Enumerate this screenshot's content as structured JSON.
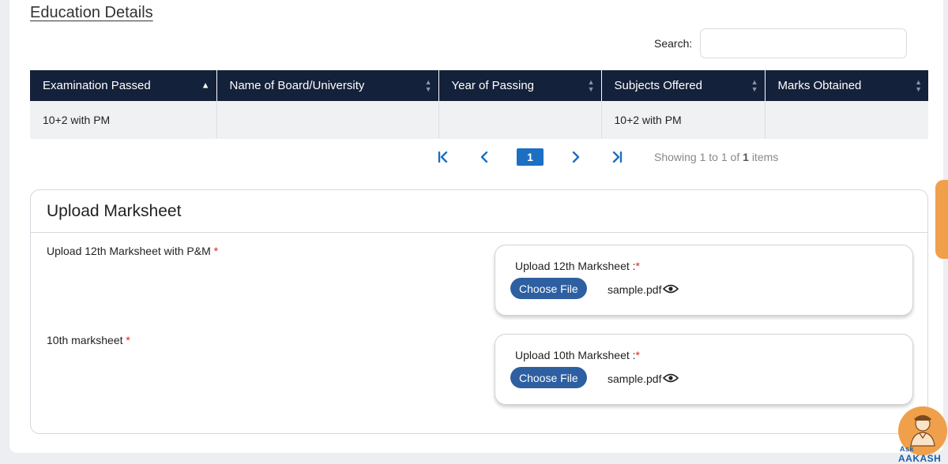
{
  "section": {
    "title": "Education Details"
  },
  "search": {
    "label": "Search:",
    "value": ""
  },
  "table": {
    "columns": [
      {
        "label": "Examination Passed",
        "sorted": "asc"
      },
      {
        "label": "Name of Board/University",
        "sorted": "none"
      },
      {
        "label": "Year of Passing",
        "sorted": "none"
      },
      {
        "label": "Subjects Offered",
        "sorted": "none"
      },
      {
        "label": "Marks Obtained",
        "sorted": "none"
      }
    ],
    "rows": [
      [
        "10+2 with PM",
        "",
        "",
        "10+2 with PM",
        ""
      ]
    ]
  },
  "pagination": {
    "current_page": "1",
    "info_prefix": "Showing",
    "info_from": "1",
    "info_to_word": "to",
    "info_to": "1",
    "info_of_word": "of",
    "info_total": "1",
    "info_suffix": "items"
  },
  "upload": {
    "title": "Upload Marksheet",
    "fields": [
      {
        "label": "Upload 12th Marksheet with P&M",
        "required_mark": "*",
        "box_label": "Upload 12th Marksheet :",
        "box_required_mark": "*",
        "button_label": "Choose File",
        "file_name": "sample.pdf"
      },
      {
        "label": "10th marksheet",
        "required_mark": "*",
        "box_label": "Upload 10th Marksheet :",
        "box_required_mark": "*",
        "button_label": "Choose File",
        "file_name": "sample.pdf"
      }
    ]
  },
  "help_widget": {
    "label": "AAKASH",
    "top_text": "Ask"
  },
  "colors": {
    "header_bg": "#14213a",
    "accent_blue": "#1c6fc2",
    "button_blue": "#2d5fa1",
    "required_red": "#e02020",
    "orange": "#f0a04b"
  }
}
